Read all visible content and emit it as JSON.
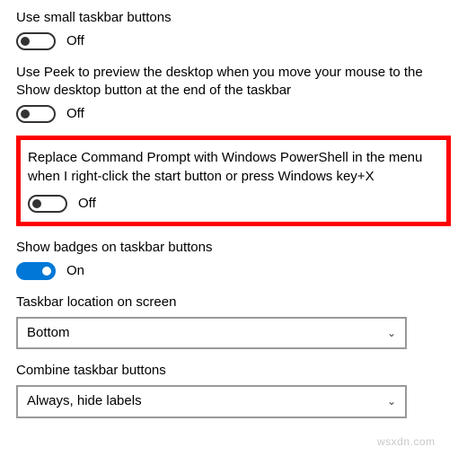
{
  "settings": {
    "smallTaskbar": {
      "label": "Use small taskbar buttons",
      "state": "off",
      "status": "Off"
    },
    "usePeek": {
      "label": "Use Peek to preview the desktop when you move your mouse to the Show desktop button at the end of the taskbar",
      "state": "off",
      "status": "Off"
    },
    "powershell": {
      "label": "Replace Command Prompt with Windows PowerShell in the menu when I right-click the start button or press Windows key+X",
      "state": "off",
      "status": "Off"
    },
    "badges": {
      "label": "Show badges on taskbar buttons",
      "state": "on",
      "status": "On"
    },
    "taskbarLocation": {
      "label": "Taskbar location on screen",
      "value": "Bottom"
    },
    "combineButtons": {
      "label": "Combine taskbar buttons",
      "value": "Always, hide labels"
    }
  },
  "watermark": "wsxdn.com"
}
